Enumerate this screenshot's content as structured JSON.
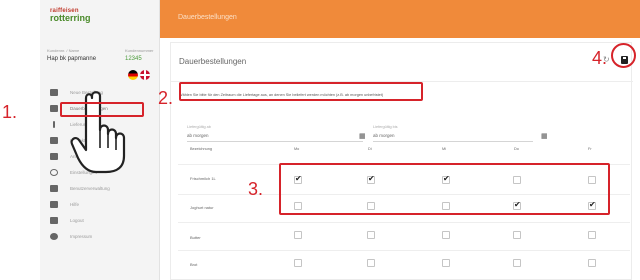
{
  "app": {
    "logo_top": "raiffeisen",
    "logo_bottom": "rotterring",
    "header_title": "Dauerbestellungen"
  },
  "user": {
    "caption_name": "Kundennr. / Name",
    "caption_number": "Kundennummer",
    "name": "Hap bk papmanne",
    "number": "12345"
  },
  "sidebar": {
    "items": [
      {
        "label": "Neue Bestellung",
        "icon": "calendar-icon"
      },
      {
        "label": "Dauerbestellungen",
        "icon": "list-icon"
      },
      {
        "label": "Lieferungen",
        "icon": "info-icon"
      },
      {
        "label": "Kontakt",
        "icon": "cart-icon"
      },
      {
        "label": "Ansprechpartner",
        "icon": "person-icon"
      },
      {
        "label": "Einstellungen",
        "icon": "settings-icon"
      },
      {
        "label": "Benutzerverwaltung",
        "icon": "card-icon"
      },
      {
        "label": "Hilfe",
        "icon": "grid-icon"
      },
      {
        "label": "Logout",
        "icon": "lock-icon"
      },
      {
        "label": "Impressum",
        "icon": "dot-icon"
      }
    ]
  },
  "card": {
    "title": "Dauerbestellungen",
    "info": "Wählen Sie bitte für den Zeitraum die Liefertage aus, an denen Sie beliefert werden möchten (z.B. ab morgen unbefristet)",
    "from_caption": "Liefergültig ab",
    "from_value": "ab morgen",
    "to_caption": "Liefergültig bis",
    "to_value": "ab morgen",
    "grid": {
      "column_headers": [
        "Bezeichnung",
        "Mo",
        "Di",
        "Mi",
        "Do",
        "Fr"
      ],
      "rows": [
        {
          "label": "Frischmilch 1L",
          "checks": [
            true,
            true,
            true,
            false,
            false
          ]
        },
        {
          "label": "Joghurt natur",
          "checks": [
            false,
            false,
            false,
            true,
            true
          ]
        },
        {
          "label": "Butter",
          "checks": [
            false,
            false,
            false,
            false,
            false
          ]
        },
        {
          "label": "Brot",
          "checks": [
            false,
            false,
            false,
            false,
            false
          ]
        }
      ]
    }
  },
  "annotations": {
    "one": "1.",
    "two": "2.",
    "three": "3.",
    "four": "4.",
    "color": "#d6232a"
  },
  "colors": {
    "header": "#f08a3a",
    "accent_green": "#4a9a3a"
  }
}
